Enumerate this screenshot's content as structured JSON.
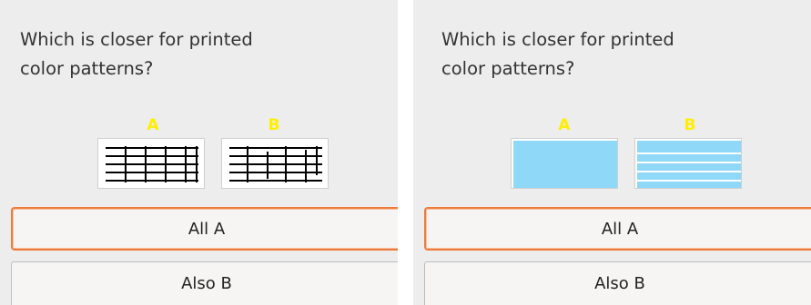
{
  "panels": [
    {
      "question": "Which is closer for printed\ncolor patterns?",
      "pattern_a_label": "A",
      "pattern_b_label": "B",
      "pattern_style": "black-grid",
      "buttons": {
        "all_a": "All A",
        "also_b": "Also B"
      }
    },
    {
      "question": "Which is closer for printed\ncolor patterns?",
      "pattern_a_label": "A",
      "pattern_b_label": "B",
      "pattern_style": "cyan-bars",
      "buttons": {
        "all_a": "All A",
        "also_b": "Also B"
      }
    }
  ],
  "colors": {
    "accent_border": "#f07a3a",
    "label_yellow": "#ffee00",
    "pattern_cyan": "#8fd8f8"
  }
}
